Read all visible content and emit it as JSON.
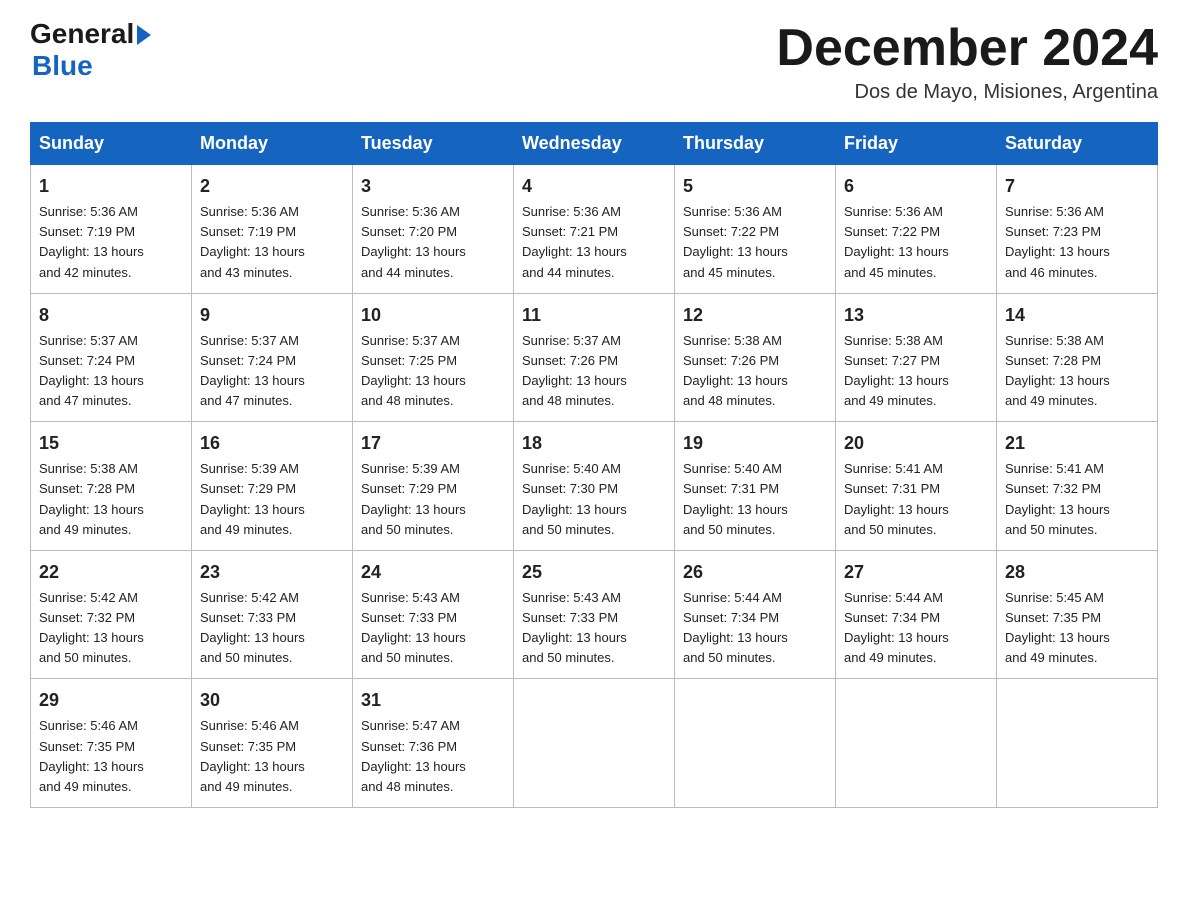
{
  "header": {
    "logo_general": "General",
    "logo_blue": "Blue",
    "month_title": "December 2024",
    "subtitle": "Dos de Mayo, Misiones, Argentina"
  },
  "days_of_week": [
    "Sunday",
    "Monday",
    "Tuesday",
    "Wednesday",
    "Thursday",
    "Friday",
    "Saturday"
  ],
  "weeks": [
    [
      {
        "day": "1",
        "sunrise": "5:36 AM",
        "sunset": "7:19 PM",
        "daylight": "13 hours and 42 minutes."
      },
      {
        "day": "2",
        "sunrise": "5:36 AM",
        "sunset": "7:19 PM",
        "daylight": "13 hours and 43 minutes."
      },
      {
        "day": "3",
        "sunrise": "5:36 AM",
        "sunset": "7:20 PM",
        "daylight": "13 hours and 44 minutes."
      },
      {
        "day": "4",
        "sunrise": "5:36 AM",
        "sunset": "7:21 PM",
        "daylight": "13 hours and 44 minutes."
      },
      {
        "day": "5",
        "sunrise": "5:36 AM",
        "sunset": "7:22 PM",
        "daylight": "13 hours and 45 minutes."
      },
      {
        "day": "6",
        "sunrise": "5:36 AM",
        "sunset": "7:22 PM",
        "daylight": "13 hours and 45 minutes."
      },
      {
        "day": "7",
        "sunrise": "5:36 AM",
        "sunset": "7:23 PM",
        "daylight": "13 hours and 46 minutes."
      }
    ],
    [
      {
        "day": "8",
        "sunrise": "5:37 AM",
        "sunset": "7:24 PM",
        "daylight": "13 hours and 47 minutes."
      },
      {
        "day": "9",
        "sunrise": "5:37 AM",
        "sunset": "7:24 PM",
        "daylight": "13 hours and 47 minutes."
      },
      {
        "day": "10",
        "sunrise": "5:37 AM",
        "sunset": "7:25 PM",
        "daylight": "13 hours and 48 minutes."
      },
      {
        "day": "11",
        "sunrise": "5:37 AM",
        "sunset": "7:26 PM",
        "daylight": "13 hours and 48 minutes."
      },
      {
        "day": "12",
        "sunrise": "5:38 AM",
        "sunset": "7:26 PM",
        "daylight": "13 hours and 48 minutes."
      },
      {
        "day": "13",
        "sunrise": "5:38 AM",
        "sunset": "7:27 PM",
        "daylight": "13 hours and 49 minutes."
      },
      {
        "day": "14",
        "sunrise": "5:38 AM",
        "sunset": "7:28 PM",
        "daylight": "13 hours and 49 minutes."
      }
    ],
    [
      {
        "day": "15",
        "sunrise": "5:38 AM",
        "sunset": "7:28 PM",
        "daylight": "13 hours and 49 minutes."
      },
      {
        "day": "16",
        "sunrise": "5:39 AM",
        "sunset": "7:29 PM",
        "daylight": "13 hours and 49 minutes."
      },
      {
        "day": "17",
        "sunrise": "5:39 AM",
        "sunset": "7:29 PM",
        "daylight": "13 hours and 50 minutes."
      },
      {
        "day": "18",
        "sunrise": "5:40 AM",
        "sunset": "7:30 PM",
        "daylight": "13 hours and 50 minutes."
      },
      {
        "day": "19",
        "sunrise": "5:40 AM",
        "sunset": "7:31 PM",
        "daylight": "13 hours and 50 minutes."
      },
      {
        "day": "20",
        "sunrise": "5:41 AM",
        "sunset": "7:31 PM",
        "daylight": "13 hours and 50 minutes."
      },
      {
        "day": "21",
        "sunrise": "5:41 AM",
        "sunset": "7:32 PM",
        "daylight": "13 hours and 50 minutes."
      }
    ],
    [
      {
        "day": "22",
        "sunrise": "5:42 AM",
        "sunset": "7:32 PM",
        "daylight": "13 hours and 50 minutes."
      },
      {
        "day": "23",
        "sunrise": "5:42 AM",
        "sunset": "7:33 PM",
        "daylight": "13 hours and 50 minutes."
      },
      {
        "day": "24",
        "sunrise": "5:43 AM",
        "sunset": "7:33 PM",
        "daylight": "13 hours and 50 minutes."
      },
      {
        "day": "25",
        "sunrise": "5:43 AM",
        "sunset": "7:33 PM",
        "daylight": "13 hours and 50 minutes."
      },
      {
        "day": "26",
        "sunrise": "5:44 AM",
        "sunset": "7:34 PM",
        "daylight": "13 hours and 50 minutes."
      },
      {
        "day": "27",
        "sunrise": "5:44 AM",
        "sunset": "7:34 PM",
        "daylight": "13 hours and 49 minutes."
      },
      {
        "day": "28",
        "sunrise": "5:45 AM",
        "sunset": "7:35 PM",
        "daylight": "13 hours and 49 minutes."
      }
    ],
    [
      {
        "day": "29",
        "sunrise": "5:46 AM",
        "sunset": "7:35 PM",
        "daylight": "13 hours and 49 minutes."
      },
      {
        "day": "30",
        "sunrise": "5:46 AM",
        "sunset": "7:35 PM",
        "daylight": "13 hours and 49 minutes."
      },
      {
        "day": "31",
        "sunrise": "5:47 AM",
        "sunset": "7:36 PM",
        "daylight": "13 hours and 48 minutes."
      },
      null,
      null,
      null,
      null
    ]
  ],
  "labels": {
    "sunrise": "Sunrise:",
    "sunset": "Sunset:",
    "daylight": "Daylight:"
  }
}
